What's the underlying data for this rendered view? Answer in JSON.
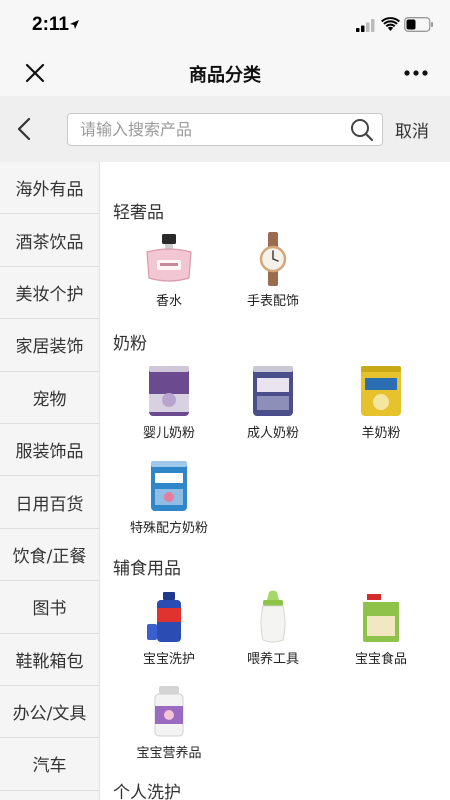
{
  "status_bar": {
    "time": "2:11"
  },
  "title_bar": {
    "title": "商品分类"
  },
  "search": {
    "placeholder": "请输入搜索产品",
    "cancel_label": "取消"
  },
  "sidebar": {
    "items": [
      {
        "label": "海外有品"
      },
      {
        "label": "酒茶饮品"
      },
      {
        "label": "美妆个护"
      },
      {
        "label": "家居装饰"
      },
      {
        "label": "宠物"
      },
      {
        "label": "服装饰品"
      },
      {
        "label": "日用百货"
      },
      {
        "label": "饮食/正餐"
      },
      {
        "label": "图书"
      },
      {
        "label": "鞋靴箱包"
      },
      {
        "label": "办公/文具"
      },
      {
        "label": "汽车"
      }
    ]
  },
  "sections": [
    {
      "title": "轻奢品",
      "items": [
        {
          "label": "香水",
          "icon": "perfume-icon"
        },
        {
          "label": "手表配饰",
          "icon": "watch-icon"
        }
      ]
    },
    {
      "title": "奶粉",
      "items": [
        {
          "label": "婴儿奶粉",
          "icon": "milk-can-icon",
          "product_text": "Anmum",
          "color": "#6b4a8f"
        },
        {
          "label": "成人奶粉",
          "icon": "milk-can-icon",
          "product_text": "",
          "color": "#4a4e8a"
        },
        {
          "label": "羊奶粉",
          "icon": "milk-can-icon",
          "product_text": "Karicare",
          "color": "#e6c22c"
        },
        {
          "label": "特殊配方奶粉",
          "icon": "milk-can-icon",
          "product_text": "Aptamil",
          "color": "#2f86c8"
        }
      ]
    },
    {
      "title": "辅食用品",
      "items": [
        {
          "label": "宝宝洗护",
          "icon": "bottle-icon"
        },
        {
          "label": "喂养工具",
          "icon": "feeding-bottle-icon"
        },
        {
          "label": "宝宝食品",
          "icon": "food-box-icon",
          "product_text": "HiPP"
        }
      ]
    },
    {
      "title": "",
      "items": [
        {
          "label": "宝宝营养品",
          "icon": "supplement-icon"
        }
      ]
    },
    {
      "title": "个人洗护",
      "items": []
    }
  ],
  "colors": {
    "accent_border": "#c9c9c9",
    "sidebar_bg": "#f5f5f5",
    "header_bg": "#f7f7f7"
  }
}
